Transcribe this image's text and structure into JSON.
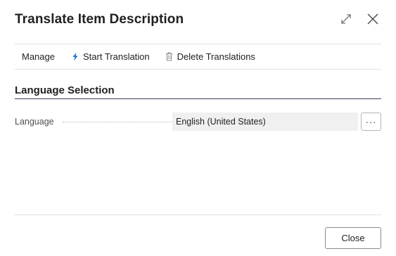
{
  "dialog": {
    "title": "Translate Item Description",
    "expand_icon": "expand-icon",
    "close_icon": "close-icon"
  },
  "actionbar": {
    "manage_label": "Manage",
    "start_translation_label": "Start Translation",
    "start_translation_icon": "lightning-icon",
    "start_translation_icon_color": "#1e6fc8",
    "delete_translations_label": "Delete Translations",
    "delete_translations_icon": "trash-icon"
  },
  "group": {
    "title": "Language Selection",
    "fields": [
      {
        "label": "Language",
        "value": "English (United States)",
        "lookup_label": "···"
      }
    ]
  },
  "footer": {
    "close_label": "Close"
  },
  "colors": {
    "accent": "#1e6fc8",
    "group_underline": "#3a3a5c",
    "field_background": "#f0f0f0"
  }
}
